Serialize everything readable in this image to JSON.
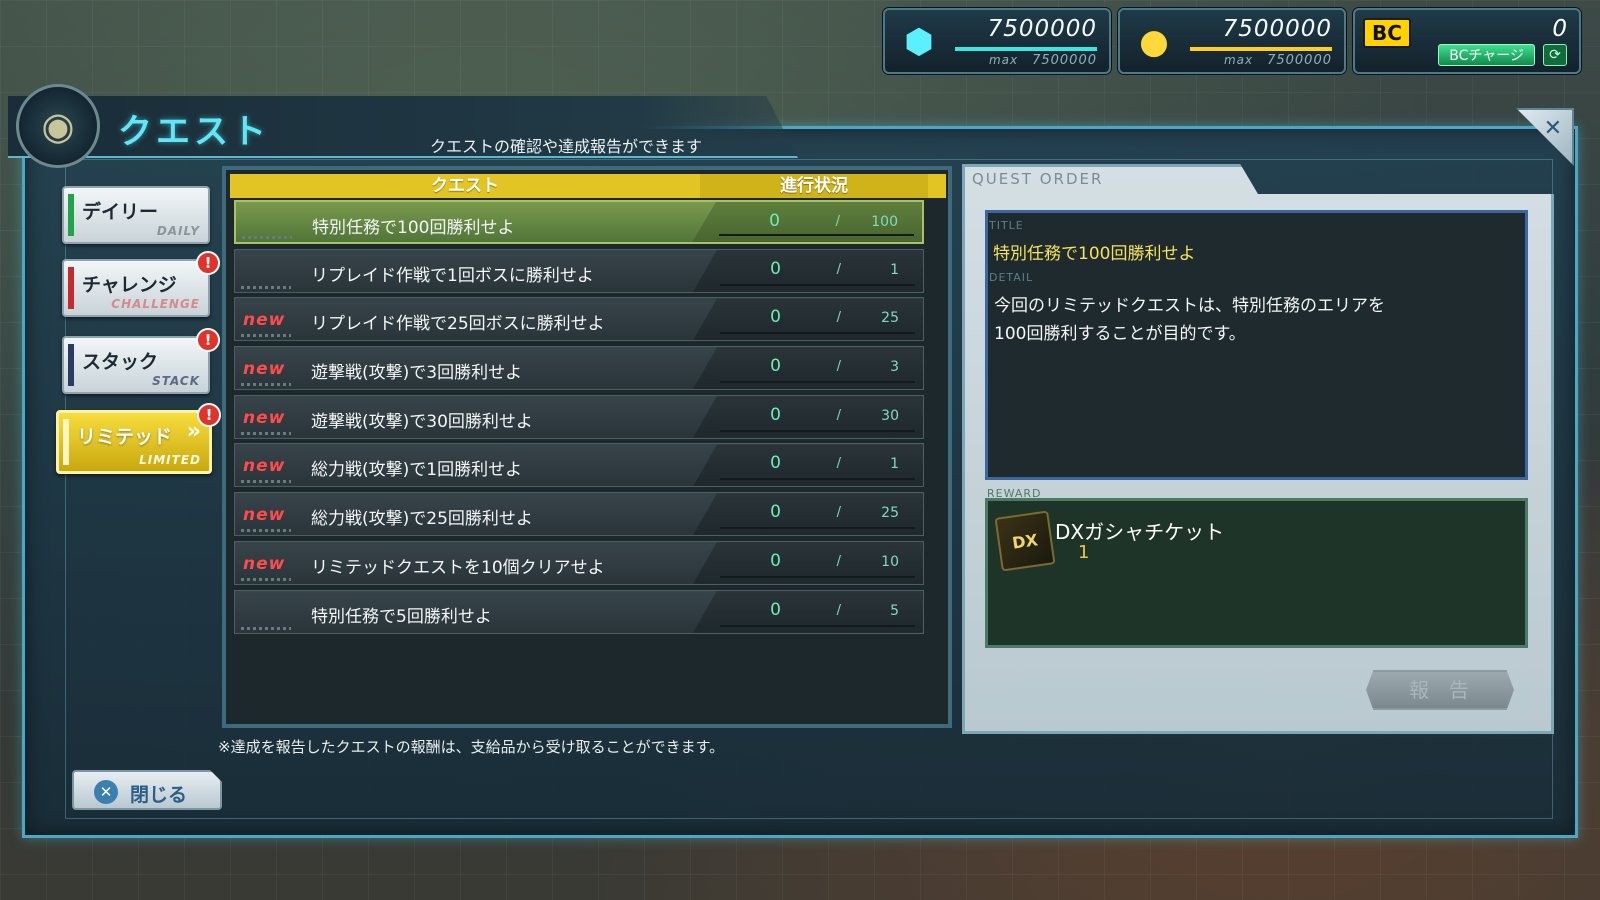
{
  "currencies": {
    "crystal": {
      "icon": "crystal-icon",
      "value": "7500000",
      "max_label": "max",
      "max": "7500000"
    },
    "coin": {
      "icon": "coin-icon",
      "value": "7500000",
      "max_label": "max",
      "max": "7500000"
    },
    "bc": {
      "badge": "BC",
      "value": "0",
      "charge_label": "BCチャージ",
      "refresh_icon": "refresh-icon"
    }
  },
  "header": {
    "title": "クエスト",
    "subtitle": "クエストの確認や達成報告ができます"
  },
  "tabs": [
    {
      "label": "デイリー",
      "sub": "DAILY",
      "badge": ""
    },
    {
      "label": "チャレンジ",
      "sub": "CHALLENGE",
      "badge": "!"
    },
    {
      "label": "スタック",
      "sub": "STACK",
      "badge": "!"
    },
    {
      "label": "リミテッド",
      "sub": "LIMITED",
      "badge": "!"
    }
  ],
  "list": {
    "header_quest": "クエスト",
    "header_progress": "進行状況",
    "new_label": "new",
    "rows": [
      {
        "name": "特別任務で100回勝利せよ",
        "current": "0",
        "sep": "/",
        "total": "100",
        "new": false
      },
      {
        "name": "リプレイド作戦で1回ボスに勝利せよ",
        "current": "0",
        "sep": "/",
        "total": "1",
        "new": false
      },
      {
        "name": "リプレイド作戦で25回ボスに勝利せよ",
        "current": "0",
        "sep": "/",
        "total": "25",
        "new": true
      },
      {
        "name": "遊撃戦(攻撃)で3回勝利せよ",
        "current": "0",
        "sep": "/",
        "total": "3",
        "new": true
      },
      {
        "name": "遊撃戦(攻撃)で30回勝利せよ",
        "current": "0",
        "sep": "/",
        "total": "30",
        "new": true
      },
      {
        "name": "総力戦(攻撃)で1回勝利せよ",
        "current": "0",
        "sep": "/",
        "total": "1",
        "new": true
      },
      {
        "name": "総力戦(攻撃)で25回勝利せよ",
        "current": "0",
        "sep": "/",
        "total": "25",
        "new": true
      },
      {
        "name": "リミテッドクエストを10個クリアせよ",
        "current": "0",
        "sep": "/",
        "total": "10",
        "new": true
      },
      {
        "name": "特別任務で5回勝利せよ",
        "current": "0",
        "sep": "/",
        "total": "5",
        "new": false
      }
    ]
  },
  "footnote": "※達成を報告したクエストの報酬は、支給品から受け取ることができます。",
  "close_button": "閉じる",
  "order": {
    "label": "QUEST ORDER",
    "title_label": "TITLE",
    "title": "特別任務で100回勝利せよ",
    "detail_label": "DETAIL",
    "detail_line1": "今回のリミテッドクエストは、特別任務のエリアを",
    "detail_line2": "100回勝利することが目的です。",
    "reward_label": "REWARD",
    "reward_icon_text": "DX",
    "reward_name": "DXガシャチケット",
    "reward_qty": "1",
    "report_button": "報告"
  }
}
